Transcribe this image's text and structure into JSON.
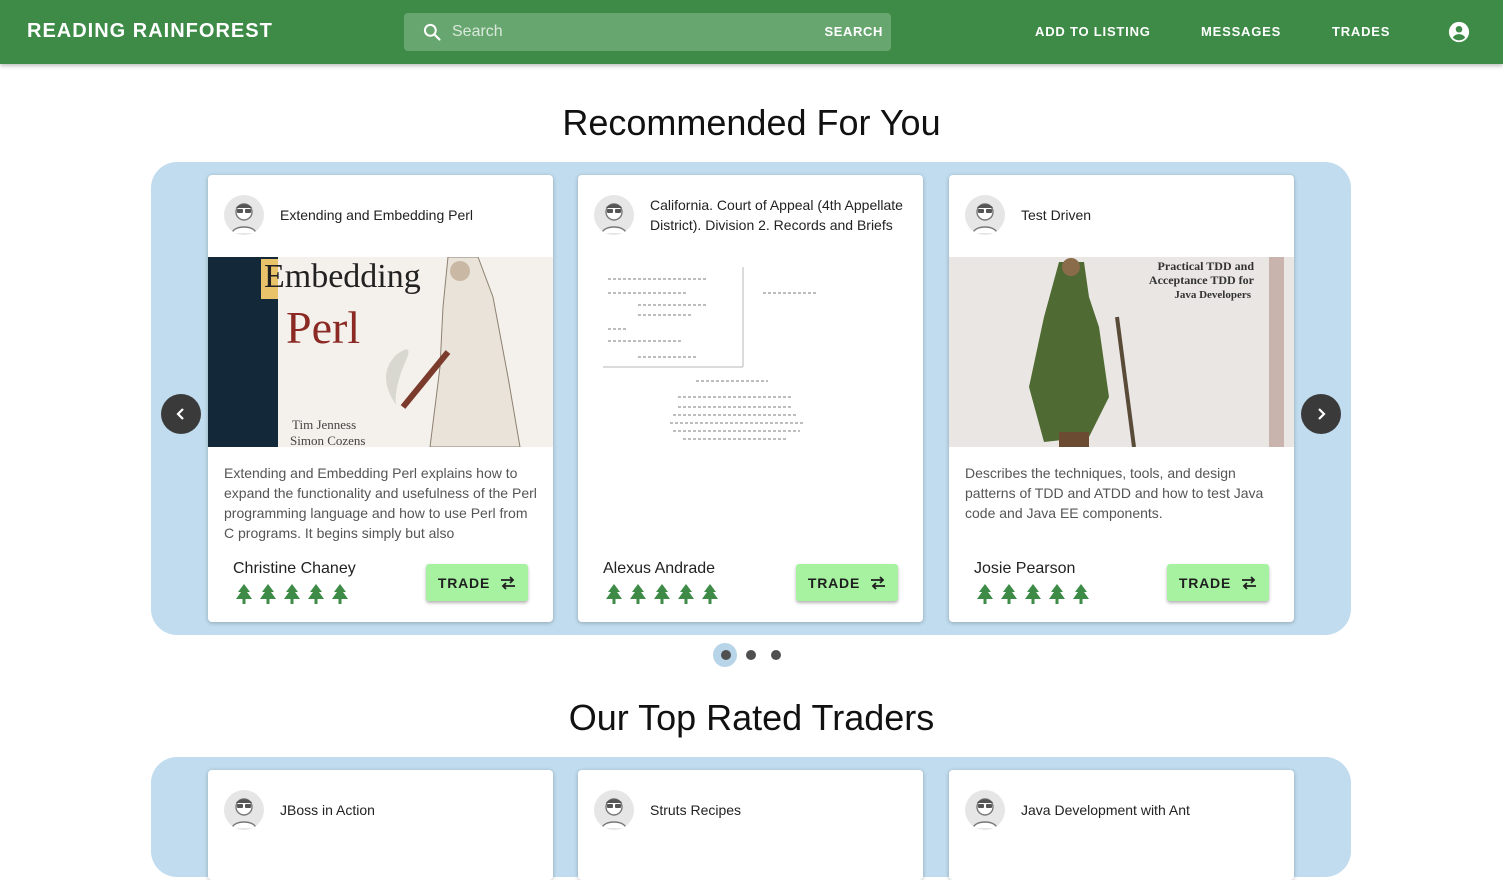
{
  "colors": {
    "topbar": "#3d8b47",
    "search_bg": "#68a66f",
    "carousel_bg": "#c0dcee",
    "trade_button": "#a6f2a1",
    "tree": "#3d8b47"
  },
  "header": {
    "brand": "READING RAINFOREST",
    "search_placeholder": "Search",
    "search_button": "SEARCH",
    "nav": {
      "add_listing": "ADD TO LISTING",
      "messages": "MESSAGES",
      "trades": "TRADES"
    },
    "account_icon": "account-circle-icon"
  },
  "recommended": {
    "title": "Recommended For You",
    "cards": [
      {
        "title": "Extending and Embedding Perl",
        "cover_text": {
          "title_line1": "Embedding",
          "title_line2": "Perl",
          "authors_line1": "Tim Jenness",
          "authors_line2": "Simon Cozens"
        },
        "description": "Extending and Embedding Perl explains how to expand the functionality and usefulness of the Perl programming language and how to use Perl from C programs. It begins simply but also",
        "owner": "Christine Chaney",
        "rating": 5,
        "trade_label": "TRADE"
      },
      {
        "title": "California. Court of Appeal (4th Appellate District). Division 2. Records and Briefs",
        "description": "",
        "owner": "Alexus Andrade",
        "rating": 5,
        "trade_label": "TRADE"
      },
      {
        "title": "Test Driven",
        "cover_text": {
          "line1": "Practical TDD and",
          "line2": "Acceptance TDD for",
          "line3": "Java Developers"
        },
        "description": "Describes the techniques, tools, and design patterns of TDD and ATDD and how to test Java code and Java EE components.",
        "owner": "Josie Pearson",
        "rating": 5,
        "trade_label": "TRADE"
      }
    ],
    "pagination": {
      "pages": 3,
      "current": 1
    }
  },
  "top_traders": {
    "title": "Our Top Rated Traders",
    "cards": [
      {
        "title": "JBoss in Action"
      },
      {
        "title": "Struts Recipes"
      },
      {
        "title": "Java Development with Ant"
      }
    ]
  }
}
